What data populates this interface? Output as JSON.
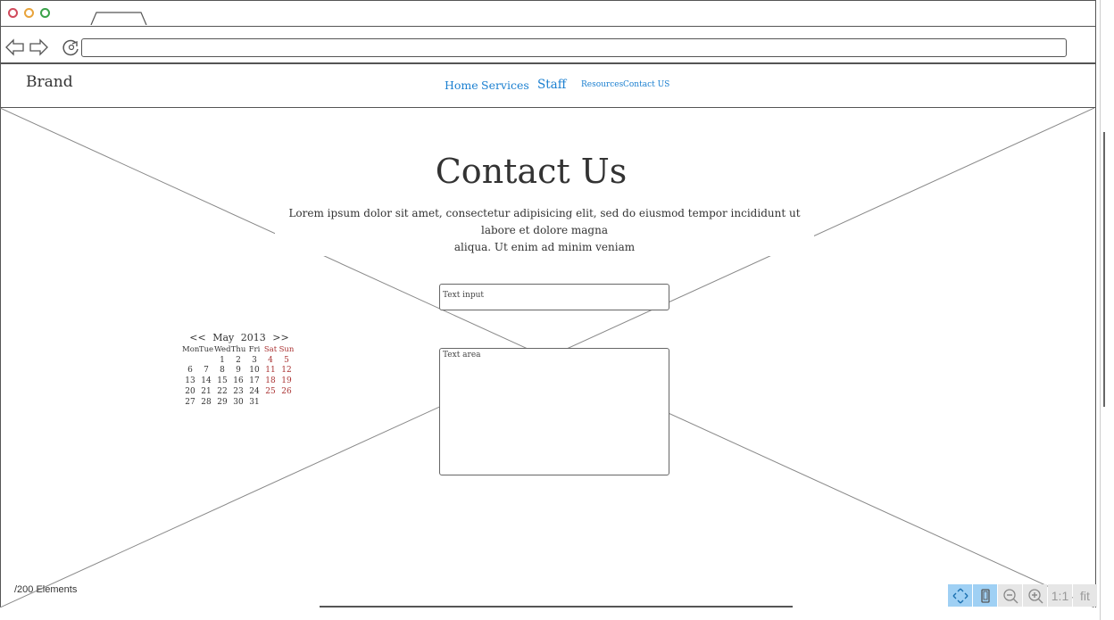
{
  "header": {
    "brand": "Brand",
    "nav": [
      "Home",
      "Services",
      "Staff",
      "Resources",
      "Contact US"
    ]
  },
  "main": {
    "title": "Contact Us",
    "lead_line1": "Lorem ipsum dolor sit amet, consectetur adipisicing elit, sed do eiusmod tempor incididunt ut labore et dolore magna",
    "lead_line2": "aliqua. Ut enim ad minim veniam",
    "text_input_placeholder": "Text input",
    "text_area_placeholder": "Text area"
  },
  "calendar": {
    "prev": "<<",
    "next": ">>",
    "month": "May",
    "year": "2013",
    "days_of_week": [
      "Mon",
      "Tue",
      "Wed",
      "Thu",
      "Fri",
      "Sat",
      "Sun"
    ],
    "weeks": [
      [
        "",
        "",
        "1",
        "2",
        "3",
        "4",
        "5"
      ],
      [
        "6",
        "7",
        "8",
        "9",
        "10",
        "11",
        "12"
      ],
      [
        "13",
        "14",
        "15",
        "16",
        "17",
        "18",
        "19"
      ],
      [
        "20",
        "21",
        "22",
        "23",
        "24",
        "25",
        "26"
      ],
      [
        "27",
        "28",
        "29",
        "30",
        "31",
        "",
        ""
      ]
    ]
  },
  "status": {
    "elements": "/200 Elements"
  },
  "toolbar": {
    "one_to_one": "1:1",
    "fit": "fit"
  },
  "colors": {
    "link": "#1a7fd0",
    "weekend": "#aa3333",
    "toolbar_active": "#9fd0f4",
    "close_dot": "#d04a5c",
    "min_dot": "#e8a33a",
    "max_dot": "#3aa24a"
  }
}
